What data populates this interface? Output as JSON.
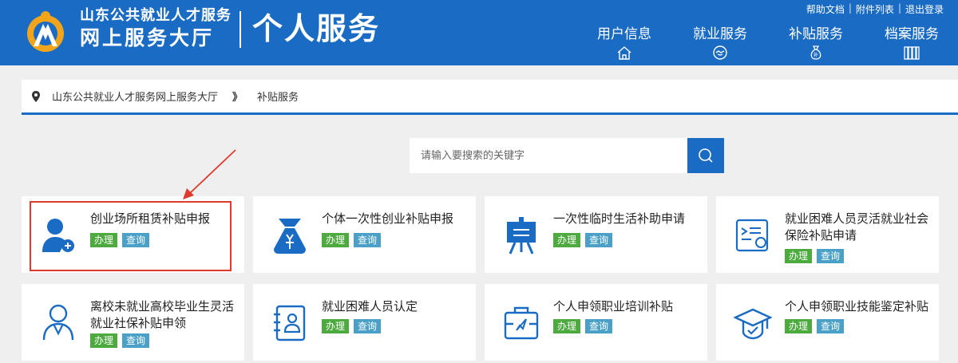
{
  "header": {
    "org_line1": "山东公共就业人才服务",
    "org_line2": "网上服务大厅",
    "title": "个人服务",
    "toplinks": [
      "帮助文档",
      "附件列表",
      "退出登录"
    ],
    "nav": [
      {
        "label": "用户信息",
        "icon": "home-icon"
      },
      {
        "label": "就业服务",
        "icon": "handshake-icon"
      },
      {
        "label": "补贴服务",
        "icon": "money-bag-icon"
      },
      {
        "label": "档案服务",
        "icon": "archive-icon"
      }
    ]
  },
  "breadcrumb": {
    "home": "山东公共就业人才服务网上服务大厅",
    "separator": "》",
    "current": "补贴服务"
  },
  "search": {
    "placeholder": "请输入要搜索的关键字"
  },
  "actions": {
    "handle": "办理",
    "query": "查询"
  },
  "cards": [
    {
      "title": "创业场所租赁补贴申报",
      "icon": "user-wrench-icon"
    },
    {
      "title": "个体一次性创业补贴申报",
      "icon": "money-bag-icon"
    },
    {
      "title": "一次性临时生活补助申请",
      "icon": "easel-icon"
    },
    {
      "title": "就业困难人员灵活就业社会保险补贴申请",
      "icon": "certificate-icon"
    },
    {
      "title": "离校未就业高校毕业生灵活就业社保补贴申领",
      "icon": "person-outline-icon"
    },
    {
      "title": "就业困难人员认定",
      "icon": "id-card-icon"
    },
    {
      "title": "个人申领职业培训补贴",
      "icon": "briefcase-icon"
    },
    {
      "title": "个人申领职业技能鉴定补贴",
      "icon": "graduation-cap-icon"
    }
  ],
  "colors": {
    "brand": "#1a6bc4",
    "handle_btn": "#4daa3e",
    "query_btn": "#4aa0c6",
    "highlight": "#e03a2f"
  }
}
